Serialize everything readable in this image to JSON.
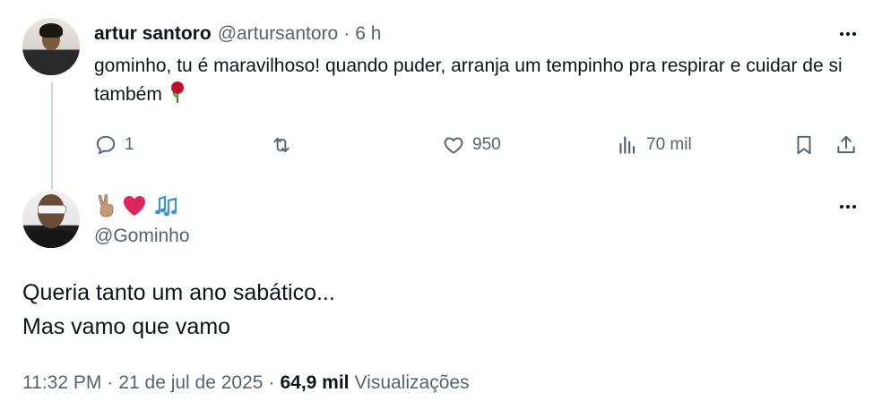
{
  "reply": {
    "name": "artur santoro",
    "handle": "@artursantoro",
    "separator": "·",
    "time": "6 h",
    "text": "gominho, tu é maravilhoso! quando puder, arranja um tempinho pra respirar e cuidar de si também",
    "emoji": "rose",
    "actions": {
      "replies": "1",
      "retweets": "",
      "likes": "950",
      "views": "70 mil"
    }
  },
  "tweet": {
    "display_name_emojis": [
      "victory-hand-medium-skin",
      "red-heart",
      "musical-notes"
    ],
    "handle": "@Gominho",
    "lines": [
      "Queria tanto um ano sabático...",
      "Mas vamo que vamo"
    ],
    "meta": {
      "time": "11:32 PM",
      "separator": "·",
      "date": "21 de jul de 2025",
      "views_count": "64,9 mil",
      "views_label": "Visualizações"
    }
  },
  "colors": {
    "text": "#0f1419",
    "secondary": "#536471",
    "thread_line": "#cfd9de",
    "heart": "#e0245e",
    "notes": "#3b94d9"
  }
}
